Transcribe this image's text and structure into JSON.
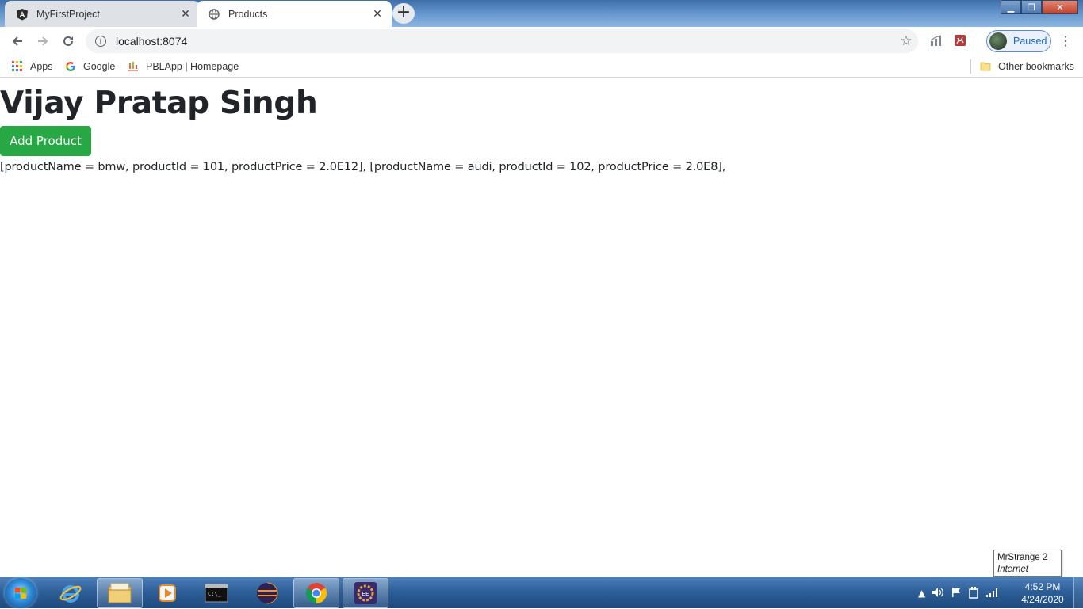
{
  "browser": {
    "tabs": [
      {
        "title": "MyFirstProject",
        "icon": "angular-icon",
        "active": false
      },
      {
        "title": "Products",
        "icon": "globe-icon",
        "active": true
      }
    ],
    "address": "localhost:8074",
    "profile_status": "Paused",
    "bookmarks": [
      {
        "label": "Apps",
        "icon": "apps-grid-icon"
      },
      {
        "label": "Google",
        "icon": "google-icon"
      },
      {
        "label": "PBLApp | Homepage",
        "icon": "pblapp-icon"
      }
    ],
    "other_bookmarks": "Other bookmarks"
  },
  "page": {
    "heading": "Vijay Pratap Singh",
    "add_button": "Add Product",
    "product_list": "[productName = bmw, productId = 101, productPrice = 2.0E12], [productName = audi, productId = 102, productPrice = 2.0E8],"
  },
  "tooltip": {
    "network": "MrStrange  2",
    "status": "Internet access"
  },
  "taskbar": {
    "time": "4:52 PM",
    "date": "4/24/2020",
    "apps": [
      "internet-explorer-icon",
      "file-explorer-icon",
      "media-player-icon",
      "command-prompt-icon",
      "eclipse-icon",
      "chrome-icon",
      "java-ee-ide-icon"
    ]
  },
  "colors": {
    "button_green": "#28a745",
    "text": "#212529",
    "profile_blue": "#1a66d2"
  }
}
